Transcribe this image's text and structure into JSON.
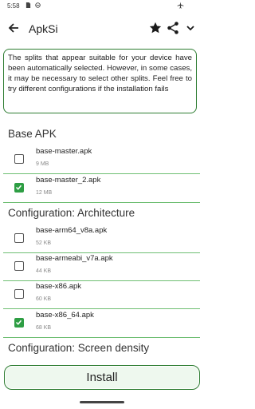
{
  "status_bar": {
    "time": "5:58"
  },
  "app_bar": {
    "title": "ApkSi"
  },
  "notice": "The splits that appear suitable for your device have been automatically selected. However, in some cases, it may be necessary to select other splits. Feel free to try different configurations if the installation fails",
  "sections": [
    {
      "title": "Base APK",
      "items": [
        {
          "name": "base-master.apk",
          "size": "9 MB",
          "checked": false
        },
        {
          "name": "base-master_2.apk",
          "size": "12 MB",
          "checked": true
        }
      ]
    },
    {
      "title": "Configuration: Architecture",
      "items": [
        {
          "name": "base-arm64_v8a.apk",
          "size": "52 KB",
          "checked": false
        },
        {
          "name": "base-armeabi_v7a.apk",
          "size": "44 KB",
          "checked": false
        },
        {
          "name": "base-x86.apk",
          "size": "60 KB",
          "checked": false
        },
        {
          "name": "base-x86_64.apk",
          "size": "68 KB",
          "checked": true
        }
      ]
    },
    {
      "title": "Configuration: Screen density",
      "items": []
    }
  ],
  "install_label": "Install",
  "colors": {
    "accent": "#2e9e44",
    "border": "#2e7d32",
    "divider": "#6fbf73"
  },
  "icons": [
    "back-arrow-icon",
    "star-icon",
    "share-icon",
    "chevron-down-icon"
  ]
}
